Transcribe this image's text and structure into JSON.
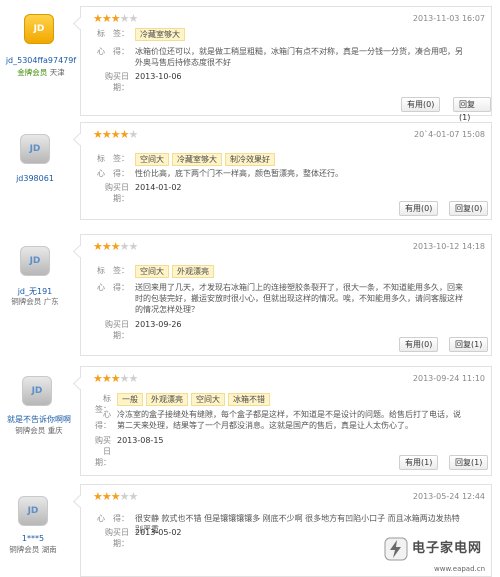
{
  "labels": {
    "tags": "标　签：",
    "comment": "心　得：",
    "buy_date": "购买日期："
  },
  "reviews": [
    {
      "username": "jd_5304ffa97479f",
      "level": "金牌会员",
      "city": "天津",
      "avatar": "gold",
      "stars": 3,
      "date": "2013-11-03 16:07",
      "tags": [
        "冷藏室够大"
      ],
      "comment": "冰箱价位还可以，就是做工稍显粗糙，冰箱门有点不对称，真是一分钱一分货，凑合用吧，另外奥马售后持修态度很不好",
      "buy_date": "2013-10-06",
      "useful": "有用(0)",
      "reply": "回复(1)"
    },
    {
      "username": "jd398061",
      "level": "",
      "city": "",
      "avatar": "silver",
      "stars": 4,
      "date": "20`4-01-07 15:08",
      "tags": [
        "空间大",
        "冷藏室够大",
        "制冷效果好"
      ],
      "comment": "性价比高，底下两个门不一样高，颜色暂漂亮，整体还行。",
      "buy_date": "2014-01-02",
      "useful": "有用(0)",
      "reply": "回复(0)"
    },
    {
      "username": "jd_无191",
      "level": "铜牌会员",
      "city": "广东",
      "avatar": "silver",
      "stars": 3,
      "date": "2013-10-12 14:18",
      "tags": [
        "空间大",
        "外观漂亮"
      ],
      "comment": "送回来用了几天，才发现右冰箱门上的连接塑胶条裂开了，很大一条，不知道能用多久，回来时的包装完好，搬运安放时很小心，但就出现这样的情况。唉，不知能用多久，请问客服这样的情况怎样处理？",
      "buy_date": "2013-09-26",
      "useful": "有用(0)",
      "reply": "回复(1)"
    },
    {
      "username": "就是不告诉你啊啊",
      "level": "铜牌会员",
      "city": "重庆",
      "avatar": "silver",
      "stars": 3,
      "date": "2013-09-24 11:10",
      "tags": [
        "一般",
        "外观漂亮",
        "空间大",
        "冰箱不错"
      ],
      "comment": "冷冻室的盒子接缝处有缝隙，每个盒子都是这样，不知道是不是设计的问题。给售后打了电话，说第二天来处理，结果等了一个月都没消息。这就是国产的售后，真是让人太伤心了。",
      "buy_date": "2013-08-15",
      "useful": "有用(1)",
      "reply": "回复(1)"
    },
    {
      "username": "1***5",
      "level": "铜牌会员",
      "city": "湖南",
      "avatar": "silver",
      "stars": 3,
      "date": "2013-05-24 12:44",
      "tags": [],
      "comment": "很安静 款式也不错 但是镶镶镶镶多 刚底不少啊 很多地方有凹陷小口子 而且冰箱两边发热特别严重",
      "buy_date": "2013-05-02",
      "useful": "",
      "reply": ""
    }
  ],
  "watermark": {
    "text": "电子家电网",
    "url": "www.eapad.cn"
  }
}
